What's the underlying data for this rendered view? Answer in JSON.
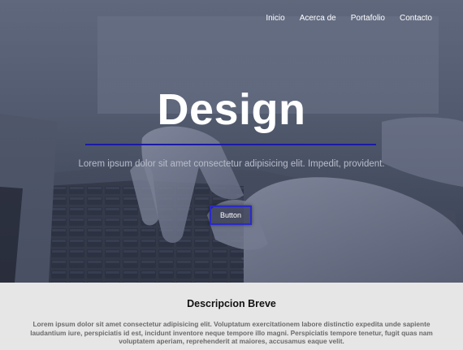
{
  "nav": {
    "items": [
      {
        "label": "Inicio"
      },
      {
        "label": "Acerca de"
      },
      {
        "label": "Portafolio"
      },
      {
        "label": "Contacto"
      }
    ]
  },
  "hero": {
    "title": "Design",
    "subtitle": "Lorem ipsum dolor sit amet consectetur adipisicing elit. Impedit, provident.",
    "button_label": "Button",
    "colors": {
      "rule": "#1a1aa8",
      "button_border": "#2a2ac8"
    }
  },
  "description": {
    "title": "Descripcion Breve",
    "text": "Lorem ipsum dolor sit amet consectetur adipisicing elit. Voluptatum exercitationem labore distinctio expedita unde sapiente laudantium iure, perspiciatis id est, incidunt inventore neque tempore illo magni. Perspiciatis tempore tenetur, fugit quas nam voluptatem aperiam, reprehenderit at maiores, accusamus eaque velit."
  }
}
